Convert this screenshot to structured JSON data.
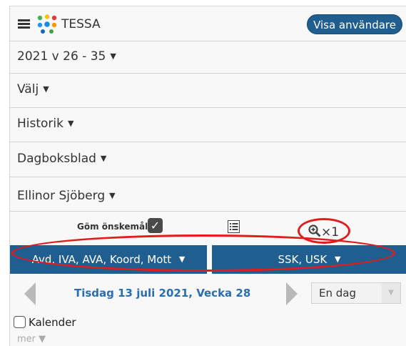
{
  "header": {
    "brand": "TESSA",
    "users_button": "Visa användare"
  },
  "rows": {
    "period": "2021 v 26 - 35",
    "select": "Välj",
    "history": "Historik",
    "diary": "Dagboksblad",
    "user": "Ellinor Sjöberg"
  },
  "caret": "▼",
  "toolbar": {
    "hide_wishes": "Göm önskemål",
    "hide_wishes_checked": "✓",
    "zoom": "×1"
  },
  "filters": {
    "units": "Avd, IVA, AVA, Koord, Mott",
    "roles": "SSK, USK"
  },
  "date_nav": {
    "date": "Tisdag 13 juli 2021, Vecka 28",
    "view_select": "En dag"
  },
  "calendar_label": "Kalender",
  "more_label": "mer ▼",
  "colors": {
    "primary": "#1f5e8f",
    "highlight": "#e21b1b",
    "date_text": "#2a6db0"
  }
}
